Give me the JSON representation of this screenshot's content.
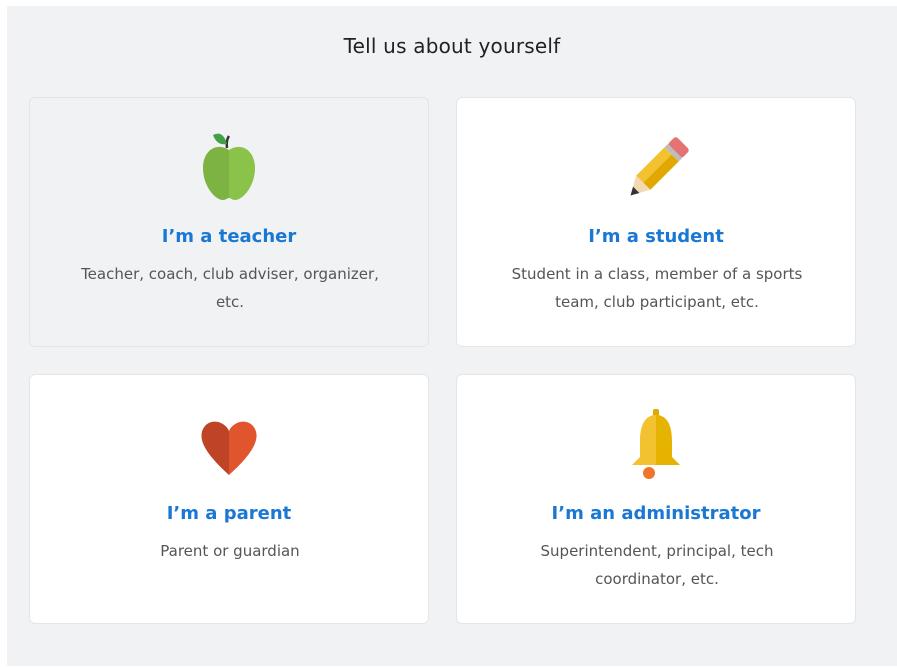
{
  "heading": "Tell us about yourself",
  "roles": [
    {
      "id": "teacher",
      "icon": "apple-icon",
      "title": "I’m a teacher",
      "description": "Teacher, coach, club adviser, organizer, etc."
    },
    {
      "id": "student",
      "icon": "pencil-icon",
      "title": "I’m a student",
      "description": "Student in a class, member of a sports team, club participant, etc."
    },
    {
      "id": "parent",
      "icon": "heart-icon",
      "title": "I’m a parent",
      "description": "Parent or guardian"
    },
    {
      "id": "administrator",
      "icon": "bell-icon",
      "title": "I’m an administrator",
      "description": "Superintendent, principal, tech coordinator, etc."
    }
  ],
  "colors": {
    "title": "#1a78d4",
    "panel_background": "#f1f2f4",
    "card_background": "#ffffff",
    "apple": "#8bc34a",
    "pencil": "#f2c230",
    "heart": "#d9532d",
    "bell": "#f5c518"
  }
}
